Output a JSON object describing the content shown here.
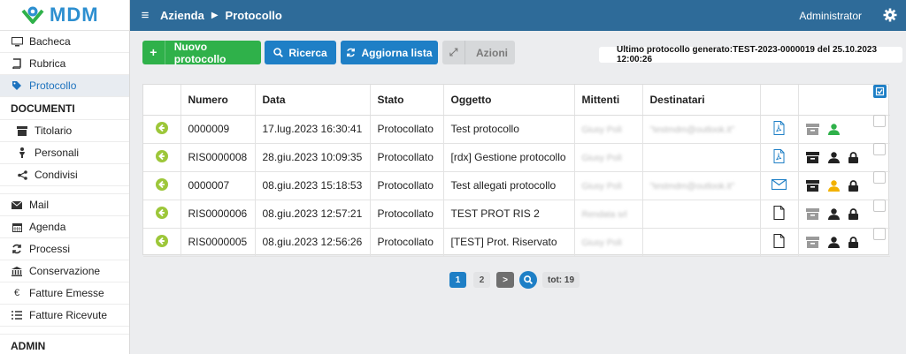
{
  "brand": {
    "name": "MDM"
  },
  "header": {
    "breadcrumb": [
      "Azienda",
      "Protocollo"
    ],
    "user": "Administrator"
  },
  "sidebar": {
    "items": [
      {
        "label": "Bacheca",
        "icon": "monitor-icon"
      },
      {
        "label": "Rubrica",
        "icon": "book-icon"
      },
      {
        "label": "Protocollo",
        "icon": "tag-icon",
        "active": true
      }
    ],
    "section_documenti": "DOCUMENTI",
    "documenti": [
      {
        "label": "Titolario",
        "icon": "archive-icon"
      },
      {
        "label": "Personali",
        "icon": "person-icon"
      },
      {
        "label": "Condivisi",
        "icon": "share-icon"
      }
    ],
    "more": [
      {
        "label": "Mail",
        "icon": "envelope-icon"
      },
      {
        "label": "Agenda",
        "icon": "calendar-icon"
      },
      {
        "label": "Processi",
        "icon": "refresh-icon"
      },
      {
        "label": "Conservazione",
        "icon": "bank-icon"
      },
      {
        "label": "Fatture Emesse",
        "icon": "euro-icon"
      },
      {
        "label": "Fatture Ricevute",
        "icon": "list-icon"
      }
    ],
    "section_admin": "ADMIN"
  },
  "toolbar": {
    "new": "Nuovo protocollo",
    "search": "Ricerca",
    "refresh": "Aggiorna lista",
    "actions": "Azioni",
    "last_generated": "Ultimo protocollo generato:TEST-2023-0000019 del 25.10.2023 12:00:26"
  },
  "table": {
    "columns": [
      "Numero",
      "Data",
      "Stato",
      "Oggetto",
      "Mittenti",
      "Destinatari"
    ],
    "rows": [
      {
        "numero": "0000009",
        "data": "17.lug.2023 16:30:41",
        "stato": "Protocollato",
        "oggetto": "Test protocollo",
        "mittenti": "Giusy Polì",
        "destinatari": "\"testmdm@outlook.it\"",
        "doc": "pdf-icon",
        "archive_color": "#9a9a9a",
        "person_color": "#2fb14a",
        "lock": false
      },
      {
        "numero": "RIS0000008",
        "data": "28.giu.2023 10:09:35",
        "stato": "Protocollato",
        "oggetto": "[rdx] Gestione protocollo",
        "mittenti": "Giusy Polì",
        "destinatari": "",
        "doc": "pdf-icon",
        "archive_color": "#222222",
        "person_color": "#222222",
        "lock": true
      },
      {
        "numero": "0000007",
        "data": "08.giu.2023 15:18:53",
        "stato": "Protocollato",
        "oggetto": "Test allegati protocollo",
        "mittenti": "Giusy Polì",
        "destinatari": "\"testmdm@outlook.it\"",
        "doc": "mail-icon",
        "archive_color": "#222222",
        "person_color": "#f2b100",
        "lock": true
      },
      {
        "numero": "RIS0000006",
        "data": "08.giu.2023 12:57:21",
        "stato": "Protocollato",
        "oggetto": "TEST PROT RIS 2",
        "mittenti": "Rendata srl",
        "destinatari": "",
        "doc": "file-icon",
        "archive_color": "#9a9a9a",
        "person_color": "#222222",
        "lock": true
      },
      {
        "numero": "RIS0000005",
        "data": "08.giu.2023 12:56:26",
        "stato": "Protocollato",
        "oggetto": "[TEST] Prot. Riservato",
        "mittenti": "Giusy Polì",
        "destinatari": "",
        "doc": "file-icon",
        "archive_color": "#9a9a9a",
        "person_color": "#222222",
        "lock": true
      }
    ]
  },
  "pagination": {
    "pages": [
      "1",
      "2"
    ],
    "next": ">",
    "total": "tot: 19",
    "current": "1"
  },
  "colors": {
    "topbar": "#2e6b99",
    "primary": "#1e7fc6",
    "success": "#2fb14a",
    "warning": "#f2b100",
    "pdf": "#1e7fc6"
  }
}
